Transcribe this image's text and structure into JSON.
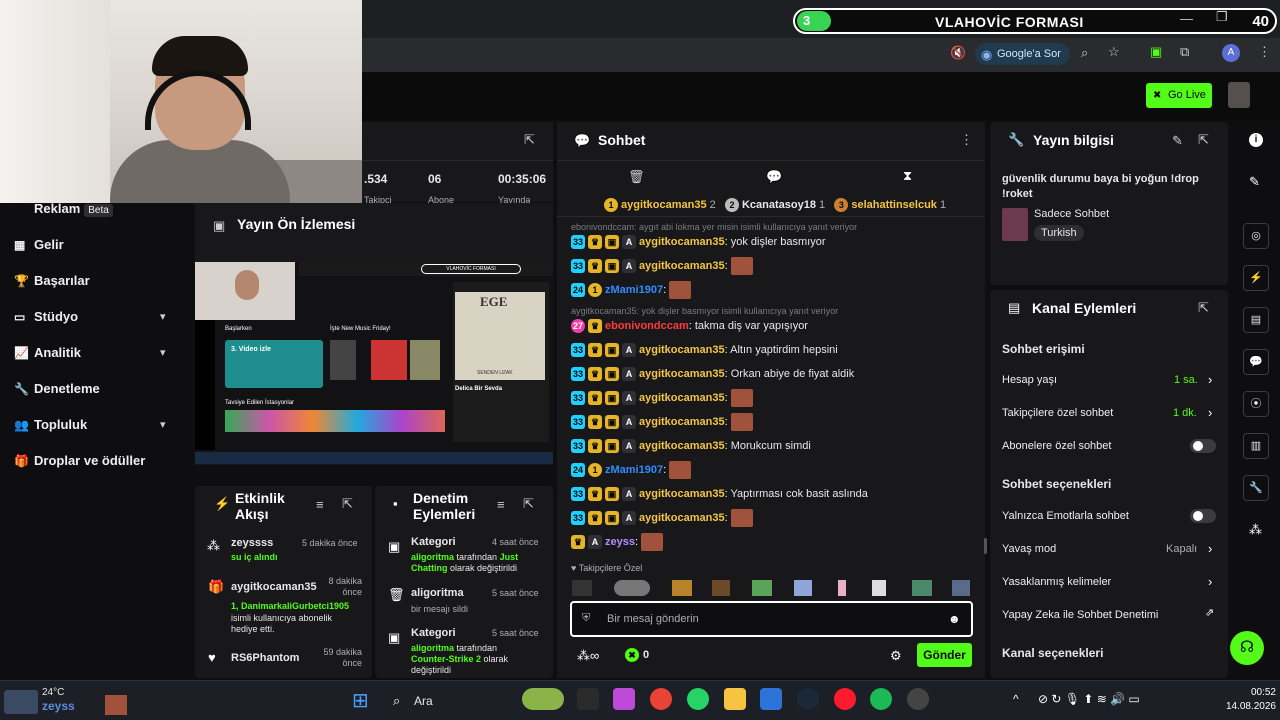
{
  "banner": {
    "count": "3",
    "title": "VLAHOVİC FORMASI",
    "right_count": "40"
  },
  "browser": {
    "google_ask": "Google'a Sor",
    "profile_initial": "A"
  },
  "header": {
    "go_live": "Go Live"
  },
  "stats": {
    "followers": ".534",
    "subs": "06",
    "uptime": "00:35:06",
    "followers_label": "Takipçi",
    "subs_label": "Abone",
    "uptime_label": "Yayında"
  },
  "sidebar": {
    "items": [
      {
        "label": "Reklam",
        "badge": "Beta"
      },
      {
        "label": "Gelir"
      },
      {
        "label": "Başarılar"
      },
      {
        "label": "Stüdyo"
      },
      {
        "label": "Analitik"
      },
      {
        "label": "Denetleme"
      },
      {
        "label": "Topluluk"
      },
      {
        "label": "Droplar ve ödüller"
      }
    ]
  },
  "preview": {
    "title": "Yayın Ön İzlemesi",
    "inner_banner": "VLAHOVİC FORMASI",
    "album_title": "EGE",
    "album_sub": "SENDEN UZAK",
    "track": "Delica Bir Sevda",
    "hero": "3. Video izle",
    "section1": "Başlarken",
    "section2": "İşte New Music Friday!",
    "section3": "Tavsiye Edilen İstasyonlar"
  },
  "activity": {
    "title": "Etkinlik Akışı",
    "items": [
      {
        "user": "zeyssss",
        "time": "5 dakika önce",
        "detail": "su iç alındı"
      },
      {
        "user": "aygitkocaman35",
        "time": "8 dakika önce",
        "detail_user": "1, DanimarkaliGurbetci1905",
        "detail": "isimli kullanıcıya abonelik hediye etti."
      },
      {
        "user": "RS6Phantom",
        "time": "59 dakika önce"
      }
    ]
  },
  "moderation": {
    "title": "Denetim Eylemleri",
    "items": [
      {
        "title": "Kategori",
        "time": "4 saat önce",
        "user": "aligoritma",
        "mid": "tarafından",
        "value": "Just Chatting",
        "tail": "olarak değiştirildi"
      },
      {
        "title": "aligoritma",
        "time": "5 saat önce",
        "detail": "bir mesajı sildi"
      },
      {
        "title": "Kategori",
        "time": "5 saat önce",
        "user": "aligoritma",
        "mid": "tarafından",
        "value": "Counter-Strike 2",
        "tail": "olarak değiştirildi"
      }
    ]
  },
  "chat": {
    "title": "Sohbet",
    "top_gifters": [
      {
        "name": "aygitkocaman35",
        "rank": "1",
        "count": "2"
      },
      {
        "name": "Kcanatasoy18",
        "rank": "2",
        "count": "1"
      },
      {
        "name": "selahattinselcuk",
        "rank": "3",
        "count": "1"
      }
    ],
    "messages": [
      {
        "reply": "ebonivondccam: aygıt abi lokma yer misin isimli kullanıcıya yanıt veriyor"
      },
      {
        "badge": "33",
        "user": "aygitkocaman35",
        "text": "yok dişler basmıyor",
        "color": "#f5c542"
      },
      {
        "badge": "33",
        "user": "aygitkocaman35",
        "text": "",
        "emote": true,
        "color": "#f5c542"
      },
      {
        "badge": "24",
        "user": "zMami1907",
        "text": "",
        "emote": true,
        "color": "#2f8cff",
        "gold": true
      },
      {
        "reply": "aygitkocaman35: yok dişler basmıyor isimli kullanıcıya yanıt veriyor"
      },
      {
        "badge": "27",
        "user": "ebonivondccam",
        "text": "takma diş var yapışıyor",
        "color": "#ff3b3b",
        "pink": true
      },
      {
        "badge": "33",
        "user": "aygitkocaman35",
        "text": "Altın yaptirdim hepsini",
        "color": "#f5c542"
      },
      {
        "badge": "33",
        "user": "aygitkocaman35",
        "text": "Orkan abiye de fiyat aldik",
        "color": "#f5c542"
      },
      {
        "badge": "33",
        "user": "aygitkocaman35",
        "text": "",
        "emote": true,
        "color": "#f5c542"
      },
      {
        "badge": "33",
        "user": "aygitkocaman35",
        "text": "",
        "emote": true,
        "color": "#f5c542"
      },
      {
        "badge": "33",
        "user": "aygitkocaman35",
        "text": "Morukcum simdi",
        "color": "#f5c542"
      },
      {
        "badge": "24",
        "user": "zMami1907",
        "text": "",
        "emote": true,
        "color": "#2f8cff",
        "gold": true
      },
      {
        "badge": "33",
        "user": "aygitkocaman35",
        "text": "Yaptırması cok basit aslında",
        "color": "#f5c542"
      },
      {
        "badge": "33",
        "user": "aygitkocaman35",
        "text": "",
        "emote": true,
        "color": "#f5c542"
      },
      {
        "user": "zeyss",
        "text": "",
        "emote": true,
        "color": "#b48cff",
        "crownonly": true
      }
    ],
    "followers_only_label": "Takipçilere Özel",
    "input_placeholder": "Bir mesaj gönderin",
    "points": "0",
    "send_label": "Gönder"
  },
  "stream_info": {
    "title": "Yayın bilgisi",
    "stream_title": "güvenlik durumu baya bi yoğun !drop !roket",
    "category": "Sadece Sohbet",
    "tag": "Turkish"
  },
  "channel_actions": {
    "title": "Kanal Eylemleri",
    "chat_access": "Sohbet erişimi",
    "rows": [
      {
        "label": "Hesap yaşı",
        "value": "1 sa."
      },
      {
        "label": "Takipçilere özel sohbet",
        "value": "1 dk."
      },
      {
        "label": "Abonelere özel sohbet"
      }
    ],
    "chat_options": "Sohbet seçenekleri",
    "rows2": [
      {
        "label": "Yalnızca Emotlarla sohbet"
      },
      {
        "label": "Yavaş mod",
        "value": "Kapalı"
      },
      {
        "label": "Yasaklanmış kelimeler"
      },
      {
        "label": "Yapay Zeka ile Sohbet Denetimi"
      }
    ],
    "channel_options": "Kanal seçenekleri"
  },
  "taskbar": {
    "temp": "24°C",
    "weather_app": "zeyss",
    "search": "Ara",
    "time": "00:52",
    "date": "14.08.2026"
  }
}
